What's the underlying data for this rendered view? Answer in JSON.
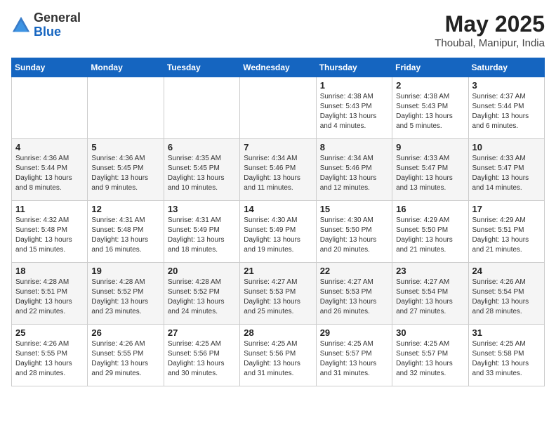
{
  "header": {
    "logo_general": "General",
    "logo_blue": "Blue",
    "month_year": "May 2025",
    "location": "Thoubal, Manipur, India"
  },
  "weekdays": [
    "Sunday",
    "Monday",
    "Tuesday",
    "Wednesday",
    "Thursday",
    "Friday",
    "Saturday"
  ],
  "weeks": [
    [
      {
        "day": "",
        "info": ""
      },
      {
        "day": "",
        "info": ""
      },
      {
        "day": "",
        "info": ""
      },
      {
        "day": "",
        "info": ""
      },
      {
        "day": "1",
        "info": "Sunrise: 4:38 AM\nSunset: 5:43 PM\nDaylight: 13 hours\nand 4 minutes."
      },
      {
        "day": "2",
        "info": "Sunrise: 4:38 AM\nSunset: 5:43 PM\nDaylight: 13 hours\nand 5 minutes."
      },
      {
        "day": "3",
        "info": "Sunrise: 4:37 AM\nSunset: 5:44 PM\nDaylight: 13 hours\nand 6 minutes."
      }
    ],
    [
      {
        "day": "4",
        "info": "Sunrise: 4:36 AM\nSunset: 5:44 PM\nDaylight: 13 hours\nand 8 minutes."
      },
      {
        "day": "5",
        "info": "Sunrise: 4:36 AM\nSunset: 5:45 PM\nDaylight: 13 hours\nand 9 minutes."
      },
      {
        "day": "6",
        "info": "Sunrise: 4:35 AM\nSunset: 5:45 PM\nDaylight: 13 hours\nand 10 minutes."
      },
      {
        "day": "7",
        "info": "Sunrise: 4:34 AM\nSunset: 5:46 PM\nDaylight: 13 hours\nand 11 minutes."
      },
      {
        "day": "8",
        "info": "Sunrise: 4:34 AM\nSunset: 5:46 PM\nDaylight: 13 hours\nand 12 minutes."
      },
      {
        "day": "9",
        "info": "Sunrise: 4:33 AM\nSunset: 5:47 PM\nDaylight: 13 hours\nand 13 minutes."
      },
      {
        "day": "10",
        "info": "Sunrise: 4:33 AM\nSunset: 5:47 PM\nDaylight: 13 hours\nand 14 minutes."
      }
    ],
    [
      {
        "day": "11",
        "info": "Sunrise: 4:32 AM\nSunset: 5:48 PM\nDaylight: 13 hours\nand 15 minutes."
      },
      {
        "day": "12",
        "info": "Sunrise: 4:31 AM\nSunset: 5:48 PM\nDaylight: 13 hours\nand 16 minutes."
      },
      {
        "day": "13",
        "info": "Sunrise: 4:31 AM\nSunset: 5:49 PM\nDaylight: 13 hours\nand 18 minutes."
      },
      {
        "day": "14",
        "info": "Sunrise: 4:30 AM\nSunset: 5:49 PM\nDaylight: 13 hours\nand 19 minutes."
      },
      {
        "day": "15",
        "info": "Sunrise: 4:30 AM\nSunset: 5:50 PM\nDaylight: 13 hours\nand 20 minutes."
      },
      {
        "day": "16",
        "info": "Sunrise: 4:29 AM\nSunset: 5:50 PM\nDaylight: 13 hours\nand 21 minutes."
      },
      {
        "day": "17",
        "info": "Sunrise: 4:29 AM\nSunset: 5:51 PM\nDaylight: 13 hours\nand 21 minutes."
      }
    ],
    [
      {
        "day": "18",
        "info": "Sunrise: 4:28 AM\nSunset: 5:51 PM\nDaylight: 13 hours\nand 22 minutes."
      },
      {
        "day": "19",
        "info": "Sunrise: 4:28 AM\nSunset: 5:52 PM\nDaylight: 13 hours\nand 23 minutes."
      },
      {
        "day": "20",
        "info": "Sunrise: 4:28 AM\nSunset: 5:52 PM\nDaylight: 13 hours\nand 24 minutes."
      },
      {
        "day": "21",
        "info": "Sunrise: 4:27 AM\nSunset: 5:53 PM\nDaylight: 13 hours\nand 25 minutes."
      },
      {
        "day": "22",
        "info": "Sunrise: 4:27 AM\nSunset: 5:53 PM\nDaylight: 13 hours\nand 26 minutes."
      },
      {
        "day": "23",
        "info": "Sunrise: 4:27 AM\nSunset: 5:54 PM\nDaylight: 13 hours\nand 27 minutes."
      },
      {
        "day": "24",
        "info": "Sunrise: 4:26 AM\nSunset: 5:54 PM\nDaylight: 13 hours\nand 28 minutes."
      }
    ],
    [
      {
        "day": "25",
        "info": "Sunrise: 4:26 AM\nSunset: 5:55 PM\nDaylight: 13 hours\nand 28 minutes."
      },
      {
        "day": "26",
        "info": "Sunrise: 4:26 AM\nSunset: 5:55 PM\nDaylight: 13 hours\nand 29 minutes."
      },
      {
        "day": "27",
        "info": "Sunrise: 4:25 AM\nSunset: 5:56 PM\nDaylight: 13 hours\nand 30 minutes."
      },
      {
        "day": "28",
        "info": "Sunrise: 4:25 AM\nSunset: 5:56 PM\nDaylight: 13 hours\nand 31 minutes."
      },
      {
        "day": "29",
        "info": "Sunrise: 4:25 AM\nSunset: 5:57 PM\nDaylight: 13 hours\nand 31 minutes."
      },
      {
        "day": "30",
        "info": "Sunrise: 4:25 AM\nSunset: 5:57 PM\nDaylight: 13 hours\nand 32 minutes."
      },
      {
        "day": "31",
        "info": "Sunrise: 4:25 AM\nSunset: 5:58 PM\nDaylight: 13 hours\nand 33 minutes."
      }
    ]
  ]
}
